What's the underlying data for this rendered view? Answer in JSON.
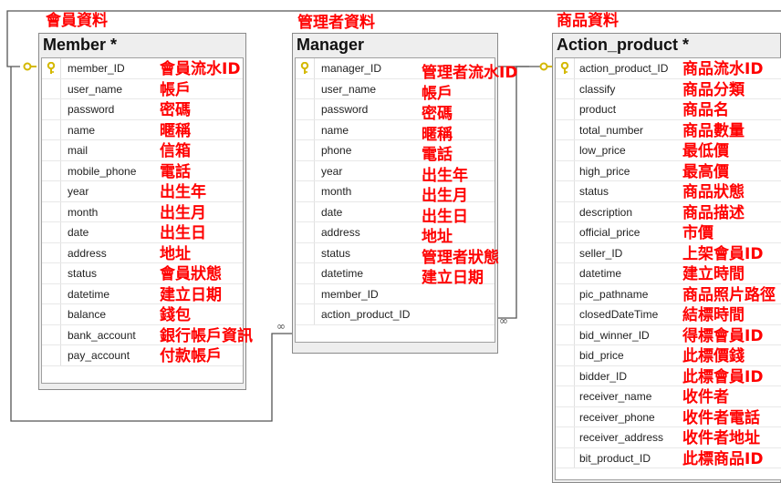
{
  "tables": {
    "member": {
      "caption": "會員資料",
      "title": "Member *",
      "columns": [
        "member_ID",
        "user_name",
        "password",
        "name",
        "mail",
        "mobile_phone",
        "year",
        "month",
        "date",
        "address",
        "status",
        "datetime",
        "balance",
        "bank_account",
        "pay_account"
      ],
      "annotations": [
        "會員流水ID",
        "帳戶",
        "密碼",
        "暱稱",
        "信箱",
        "電話",
        "出生年",
        "出生月",
        "出生日",
        "地址",
        "會員狀態",
        "建立日期",
        "錢包",
        "銀行帳戶資訊",
        "付款帳戶"
      ],
      "primary_key": "member_ID"
    },
    "manager": {
      "caption": "管理者資料",
      "title": "Manager",
      "columns": [
        "manager_ID",
        "user_name",
        "password",
        "name",
        "phone",
        "year",
        "month",
        "date",
        "address",
        "status",
        "datetime",
        "member_ID",
        "action_product_ID"
      ],
      "annotations": [
        "管理者流水ID",
        "帳戶",
        "密碼",
        "暱稱",
        "電話",
        "出生年",
        "出生月",
        "出生日",
        "地址",
        "管理者狀態",
        "建立日期"
      ],
      "primary_key": "manager_ID"
    },
    "action_product": {
      "caption": "商品資料",
      "title": "Action_product *",
      "columns": [
        "action_product_ID",
        "classify",
        "product",
        "total_number",
        "low_price",
        "high_price",
        "status",
        "description",
        "official_price",
        "seller_ID",
        "datetime",
        "pic_pathname",
        "closedDateTime",
        "bid_winner_ID",
        "bid_price",
        "bidder_ID",
        "receiver_name",
        "receiver_phone",
        "receiver_address",
        "bit_product_ID"
      ],
      "annotations": [
        "商品流水ID",
        "商品分類",
        "商品名",
        "商品數量",
        "最低價",
        "最高價",
        "商品狀態",
        "商品描述",
        "市價",
        "上架會員ID",
        "建立時間",
        "商品照片路徑",
        "結標時間",
        "得標會員ID",
        "此標價錢",
        "此標會員ID",
        "收件者",
        "收件者電話",
        "收件者地址",
        "此標商品ID"
      ],
      "primary_key": "action_product_ID"
    }
  },
  "colors": {
    "annotation": "#ff0000",
    "key_icon": "#d4b800",
    "connector": "#555555"
  },
  "icons": {
    "primary_key": "key-icon",
    "relationship_one": "key-end-connector-icon",
    "relationship_many": "infinity-end-connector-icon"
  }
}
